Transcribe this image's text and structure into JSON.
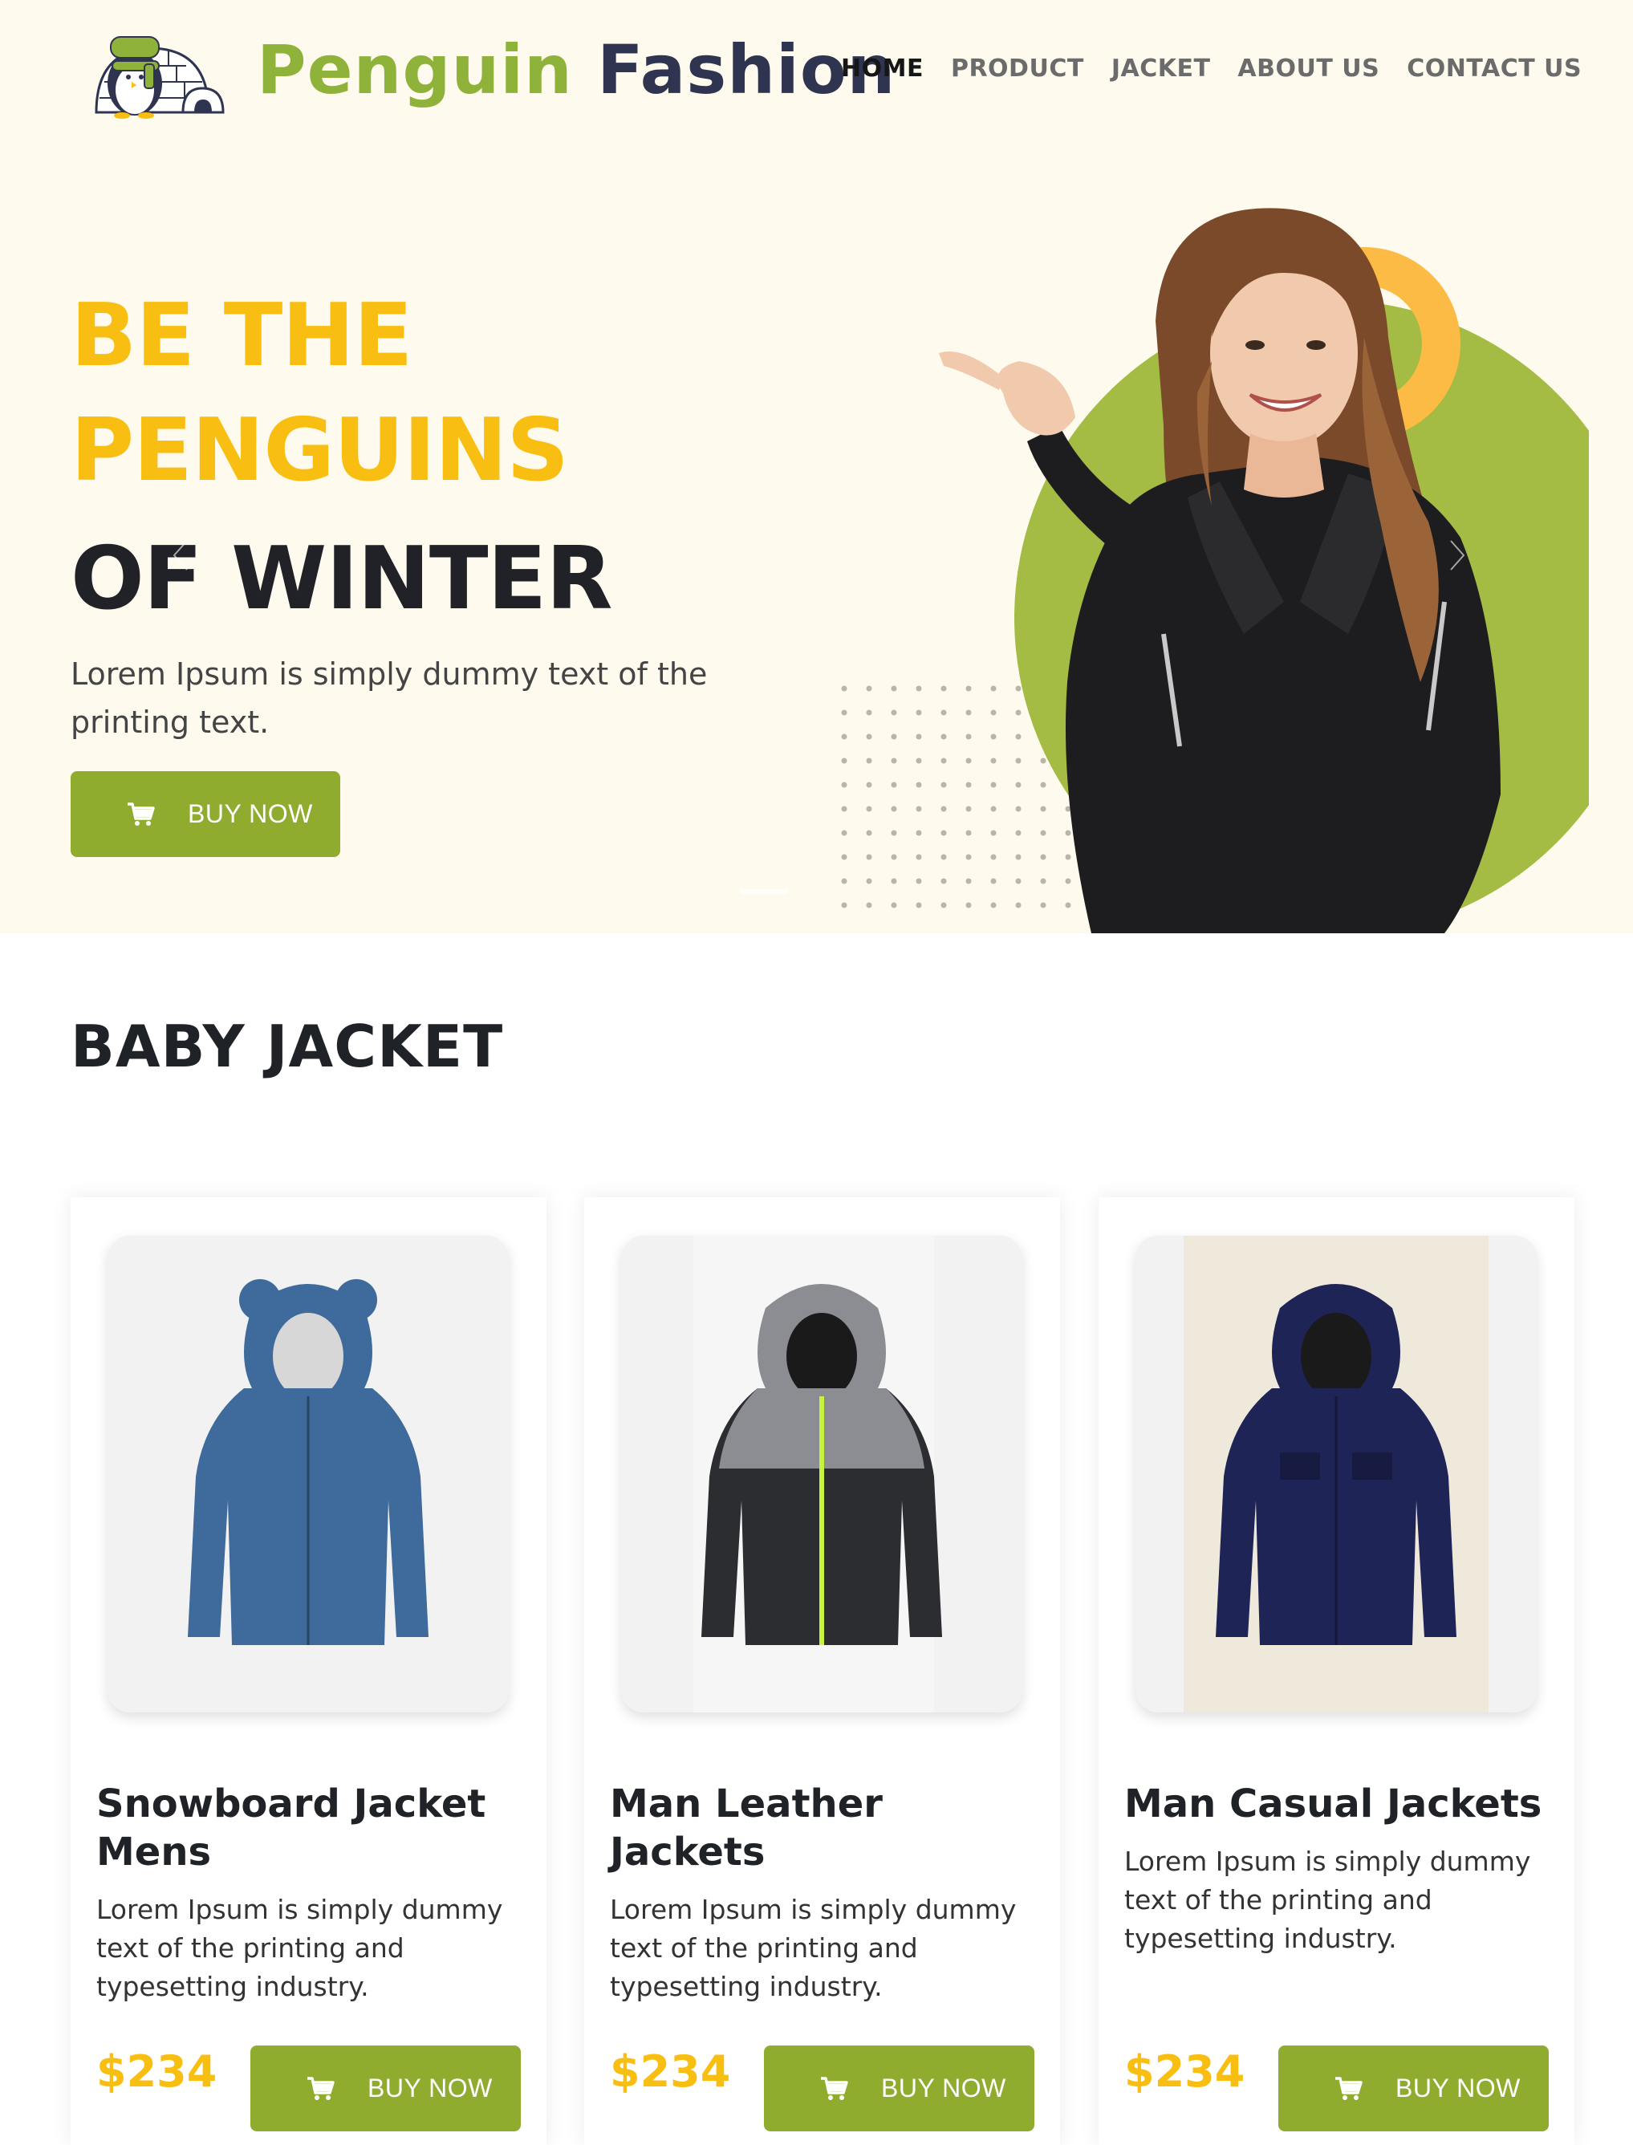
{
  "brand": {
    "name_part1": "Penguin",
    "name_part2": "Fashion"
  },
  "nav": {
    "items": [
      {
        "label": "HOME",
        "active": true
      },
      {
        "label": "PRODUCT",
        "active": false
      },
      {
        "label": "JACKET",
        "active": false
      },
      {
        "label": "ABOUT US",
        "active": false
      },
      {
        "label": "CONTACT US",
        "active": false
      }
    ]
  },
  "hero": {
    "line1": "BE THE",
    "line2": "PENGUINS",
    "line3": "OF WINTER",
    "text": "Lorem Ipsum is simply dummy text of the printing text.",
    "button_label": "BUY NOW"
  },
  "section": {
    "title": "BABY JACKET"
  },
  "products": [
    {
      "title": "Snowboard Jacket Mens",
      "desc": "Lorem Ipsum is simply dummy text of the printing and typesetting industry.",
      "price": "$234",
      "button_label": "BUY NOW",
      "jacket_color": "#3e6b9c"
    },
    {
      "title": "Man Leather Jackets",
      "desc": "Lorem Ipsum is simply dummy text of the printing and typesetting industry.",
      "price": "$234",
      "button_label": "BUY NOW",
      "jacket_color": "#2b2d30"
    },
    {
      "title": "Man Casual Jackets",
      "desc": "Lorem Ipsum is simply dummy text of the printing and typesetting industry.",
      "price": "$234",
      "button_label": "BUY NOW",
      "jacket_color": "#1f2457"
    }
  ],
  "colors": {
    "accent_green": "#8fac2e",
    "accent_yellow": "#f8be12",
    "hero_bg": "#fffaee",
    "brand_dark": "#2f3450"
  },
  "icons": {
    "cart": "cart-icon",
    "logo": "penguin-igloo-logo"
  }
}
